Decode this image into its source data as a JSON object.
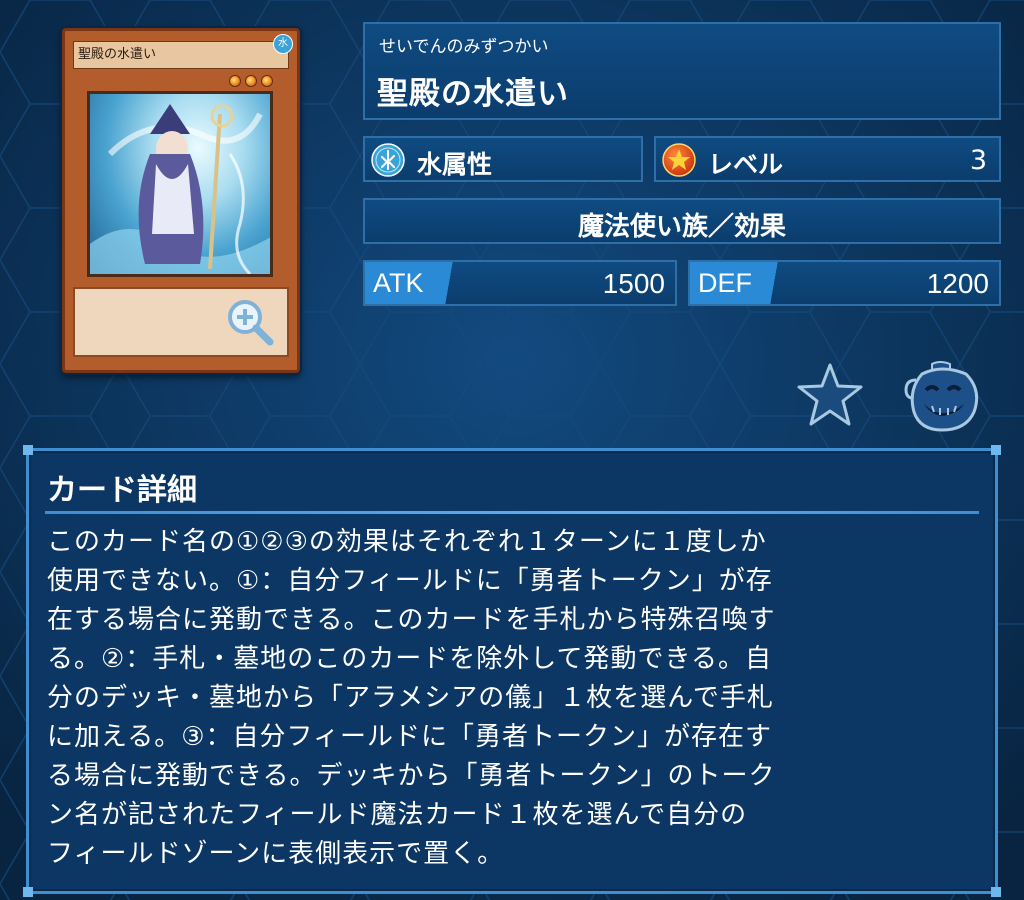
{
  "card_image": {
    "title": "聖殿の水遣い",
    "attribute_glyph": "水",
    "level_stars": 3
  },
  "card": {
    "furigana": "せいでんのみずつかい",
    "name": "聖殿の水遣い",
    "attribute": {
      "label": "水属性",
      "icon": "water-attribute-icon",
      "color": "#3aa3d8"
    },
    "level": {
      "label": "レベル",
      "value": "3",
      "icon": "level-star-icon",
      "color": "#e8551f"
    },
    "type": "魔法使い族／効果",
    "atk": {
      "label": "ATK",
      "value": "1500"
    },
    "def": {
      "label": "DEF",
      "value": "1200"
    }
  },
  "actions": {
    "zoom_icon": "zoom-in-icon",
    "favorite_icon": "favorite-star-icon",
    "deck_icon": "pot-of-greed-icon"
  },
  "details": {
    "heading": "カード詳細",
    "text": "このカード名の①②③の効果はそれぞれ１ターンに１度しか\n使用できない。①：自分フィールドに「勇者トークン」が存\n在する場合に発動できる。このカードを手札から特殊召喚す\nる。②：手札・墓地のこのカードを除外して発動できる。自\n分のデッキ・墓地から「アラメシアの儀」１枚を選んで手札\nに加える。③：自分フィールドに「勇者トークン」が存在す\nる場合に発動できる。デッキから「勇者トークン」のトーク\nン名が記されたフィールド魔法カード１枚を選んで自分の\nフィールドゾーンに表側表示で置く。"
  },
  "colors": {
    "background": "#0b2f55",
    "panel": "#0f4b82",
    "panel_border": "#2e6fa7",
    "stat_tag": "#2b8ad6",
    "detail_border": "#3d8fd1"
  }
}
